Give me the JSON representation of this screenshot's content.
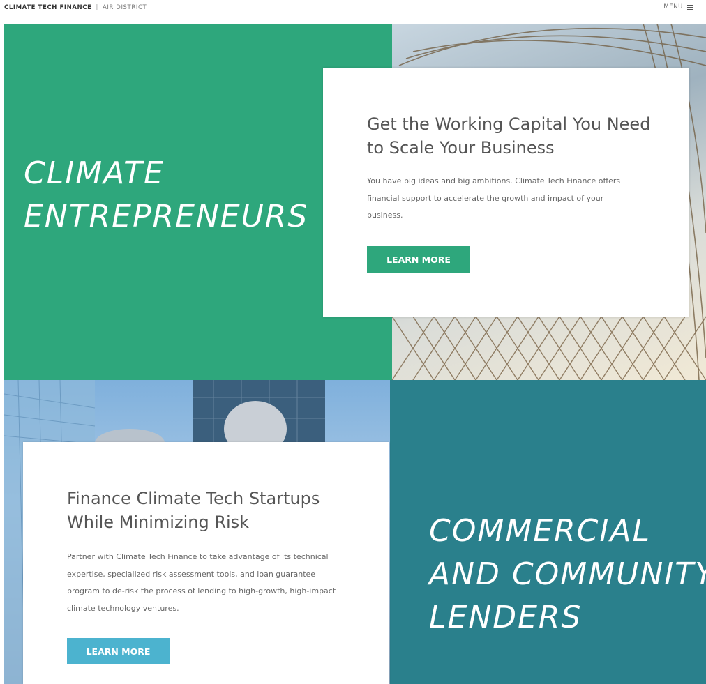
{
  "header": {
    "brand": "CLIMATE TECH FINANCE",
    "separator": "|",
    "sub_brand": "AIR DISTRICT",
    "menu_label": "MENU"
  },
  "entrepreneurs": {
    "heading_lines": [
      "CLIMATE",
      "ENTREPRENEURS"
    ],
    "card": {
      "title_lines": [
        "Get the Working Capital You Need",
        "to Scale Your Business"
      ],
      "body_lines": [
        "You have big ideas and big ambitions. Climate Tech Finance offers",
        "financial support to accelerate the growth and impact of your",
        "business."
      ],
      "button_label": "LEARN MORE"
    }
  },
  "lenders": {
    "heading_lines": [
      "COMMERCIAL",
      "AND COMMUNITY",
      "LENDERS"
    ],
    "card": {
      "title_lines": [
        "Finance Climate Tech Startups",
        "While Minimizing Risk"
      ],
      "body_lines": [
        "Partner with Climate Tech Finance to take advantage of its technical",
        "expertise, specialized risk assessment tools, and loan guarantee",
        "program to de-risk the process of lending to high-growth, high-impact",
        "climate technology ventures."
      ],
      "button_label": "LEARN MORE"
    }
  },
  "colors": {
    "green_panel": "#2ea77c",
    "teal_panel": "#2a808c",
    "green_button": "#2ea77c",
    "blue_button": "#4cb3cf"
  },
  "icons": [
    "hamburger-menu-icon"
  ]
}
